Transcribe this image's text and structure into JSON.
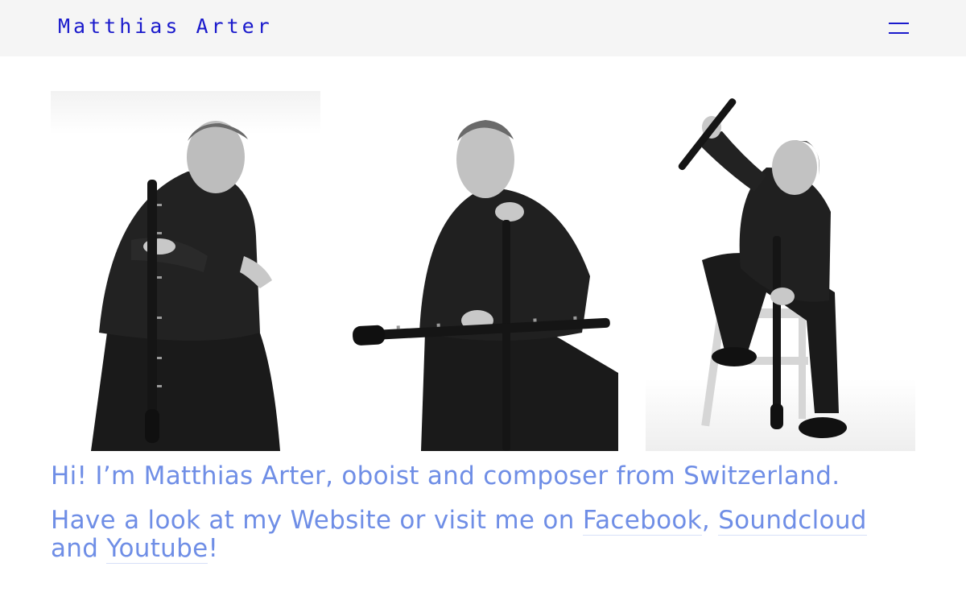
{
  "header": {
    "site_title": "Matthias Arter",
    "menu_icon": "hamburger-menu-icon",
    "accent_color": "#1a1acc",
    "background": "#f5f5f5"
  },
  "gallery": {
    "photos": [
      {
        "subject": "oboist-kneeling-with-oboe"
      },
      {
        "subject": "oboist-seated-with-two-oboes"
      },
      {
        "subject": "oboist-seated-raising-oboe"
      }
    ]
  },
  "content": {
    "intro": "Hi! I’m Matthias Arter, oboist and composer from Switzerland.",
    "links_prefix": "Have a look at my Website or visit me on ",
    "facebook": "Facebook",
    "sep1": ", ",
    "soundcloud": "Soundcloud",
    "sep2": " and ",
    "youtube": "Youtube",
    "suffix": "!",
    "text_color": "#6f8ee6"
  }
}
